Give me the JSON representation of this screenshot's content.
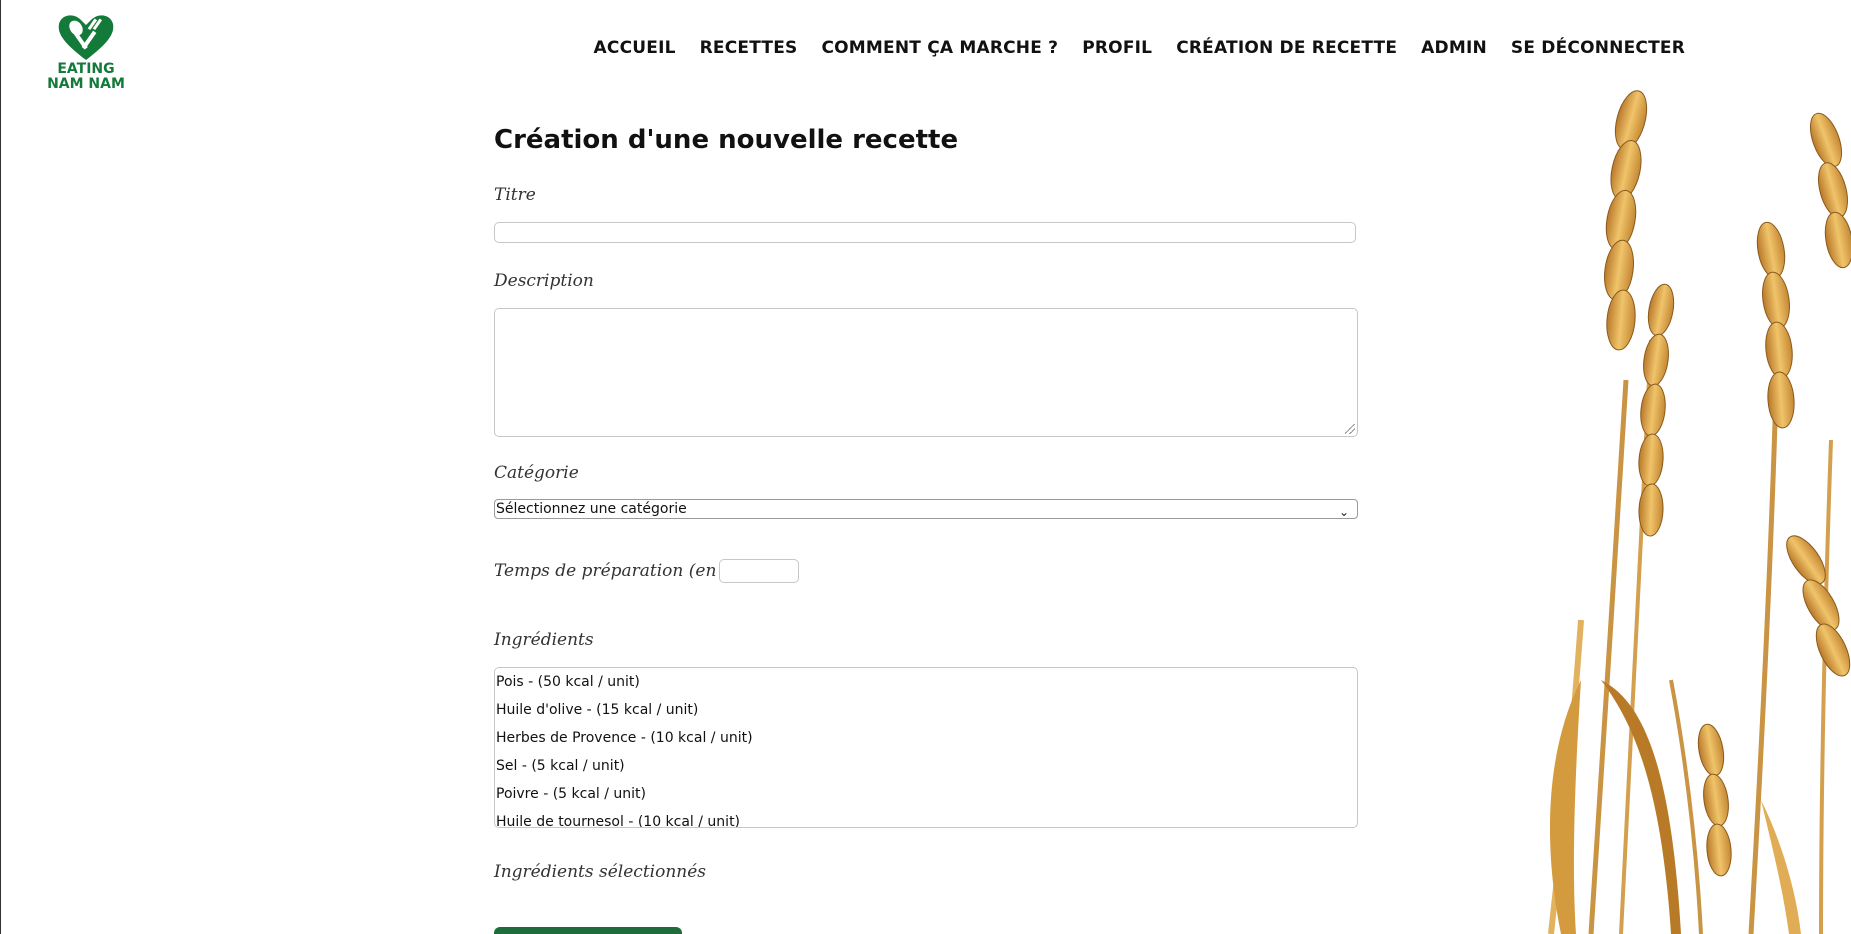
{
  "logo": {
    "line1": "EATING",
    "line2": "NAM NAM",
    "icon": "heart-fork-spoon-icon",
    "color": "#137a3a"
  },
  "nav": {
    "items": [
      {
        "label": "ACCUEIL"
      },
      {
        "label": "RECETTES"
      },
      {
        "label": "COMMENT ÇA MARCHE ?"
      },
      {
        "label": "PROFIL"
      },
      {
        "label": "CRÉATION DE RECETTE"
      },
      {
        "label": "ADMIN"
      },
      {
        "label": "SE DÉCONNECTER"
      }
    ]
  },
  "form": {
    "title": "Création d'une nouvelle recette",
    "titre_label": "Titre",
    "titre_value": "",
    "description_label": "Description",
    "description_value": "",
    "categorie_label": "Catégorie",
    "categorie_selected": "Sélectionnez une catégorie",
    "temps_label": "Temps de préparation (en min)",
    "temps_value": "",
    "ingredients_label": "Ingrédients",
    "ingredients_options": [
      "Pois - (50 kcal / unit)",
      "Huile d'olive - (15 kcal / unit)",
      "Herbes de Provence - (10 kcal / unit)",
      "Sel - (5 kcal / unit)",
      "Poivre - (5 kcal / unit)",
      "Huile de tournesol - (10 kcal / unit)"
    ],
    "selected_label": "Ingrédients sélectionnés"
  },
  "colors": {
    "brand_green": "#137a3a",
    "button_green": "#1e6b3b",
    "wheat_gold": "#d9a441"
  }
}
